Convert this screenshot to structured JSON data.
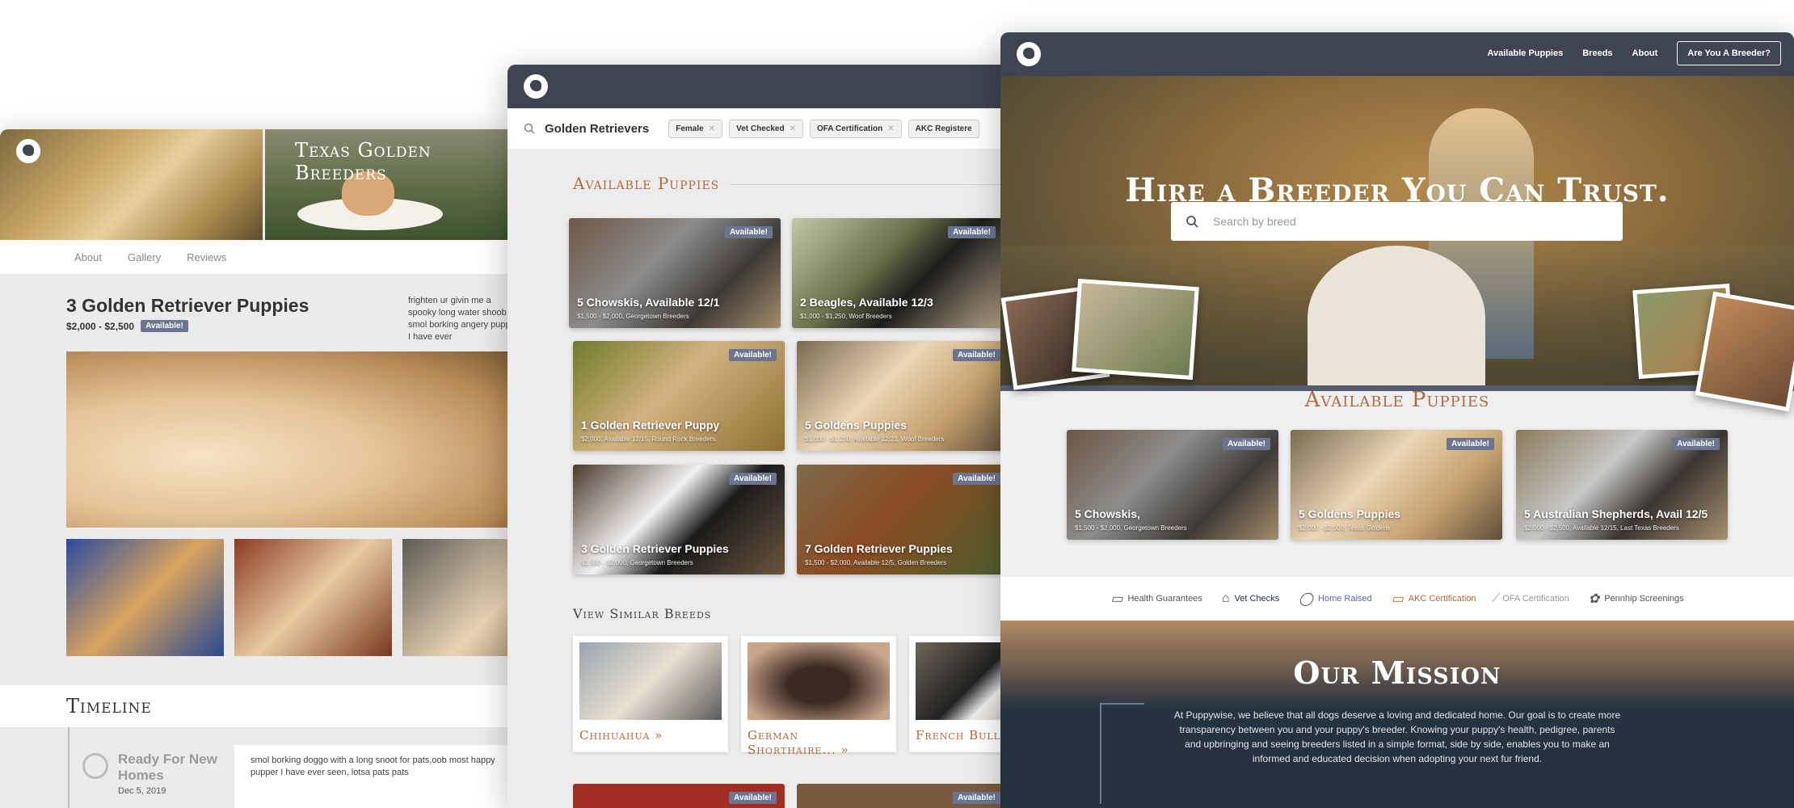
{
  "profile": {
    "breeder_name": "Texas Golden Breeders",
    "nav": [
      "About",
      "Gallery",
      "Reviews"
    ],
    "listing_title": "3 Golden Retriever Puppies",
    "price": "$2,000 - $2,500",
    "badge": "Available!",
    "description": "frighten ur givin me a spooky long water shoob smol borking angery pupper I have ever",
    "timeline_title": "Timeline",
    "timeline_event": {
      "heading": "Ready For New Homes",
      "date": "Dec 5, 2019",
      "text": "smol borking doggo with a long snoot for pats,oob most happy pupper I have ever seen, lotsa pats pats"
    }
  },
  "search": {
    "query": "Golden Retrievers",
    "filters": [
      "Female",
      "Vet Checked",
      "OFA Certification",
      "AKC Registere"
    ],
    "available_heading": "Available Puppies",
    "cards": [
      {
        "title": "5 Chowskis, Available 12/1",
        "sub": "$1,500 - $2,000, Georgetown Breeders",
        "badge": "Available!"
      },
      {
        "title": "2 Beagles, Available 12/3",
        "sub": "$1,000 - $1,250, Woof Breeders",
        "badge": "Available!"
      },
      {
        "title": "1 Golden Retriever Puppy",
        "sub": "$2,000, Available 12/15, Round Rock Breeders",
        "badge": "Available!"
      },
      {
        "title": "5 Goldens Puppies",
        "sub": "$1,000 - $1,250, Available 12/23, Woof Breeders",
        "badge": "Available!"
      },
      {
        "title": "3 Golden Retriever Puppies",
        "sub": "$1,500 - $2,000, Georgetown Breeders",
        "badge": "Available!"
      },
      {
        "title": "7 Golden Retriever Puppies",
        "sub": "$1,500 - $2,000, Available 12/5, Golden Breeders",
        "badge": "Available!"
      }
    ],
    "similar_heading": "View Similar Breeds",
    "similar": [
      "Chihuahua »",
      "German Shorthaire... »",
      "French Bulldo"
    ],
    "bottom_badges": [
      "Available!",
      "Available!"
    ]
  },
  "home": {
    "nav": [
      "Available Puppies",
      "Breeds",
      "About"
    ],
    "cta": "Are You A Breeder?",
    "hero_title": "Hire a Breeder You Can Trust.",
    "search_placeholder": "Search by breed",
    "available_heading": "Available Puppies",
    "cards": [
      {
        "title": "5 Chowskis,",
        "sub": "$1,500 - $2,000, Georgetown Breeders",
        "badge": "Available!"
      },
      {
        "title": "5 Goldens Puppies",
        "sub": "$2,000 - $2,500, Texas Goldens",
        "badge": "Available!"
      },
      {
        "title": "5 Australian Shepherds, Avail 12/5",
        "sub": "$2,000 - $2,500, Available 12/15, Last Texas Breeders",
        "badge": "Available!"
      }
    ],
    "features": [
      {
        "label": "Health Guarantees",
        "icon": "certificate-icon",
        "color": "#555555"
      },
      {
        "label": "Vet Checks",
        "icon": "clinic-icon",
        "color": "#25323f"
      },
      {
        "label": "Home Raised",
        "icon": "apple-icon",
        "color": "#5a6a9a"
      },
      {
        "label": "AKC Certification",
        "icon": "certificate-icon",
        "color": "#b36a3f"
      },
      {
        "label": "OFA Certification",
        "icon": "bone-icon",
        "color": "#999999"
      },
      {
        "label": "Pennhip Screenings",
        "icon": "paw-icon",
        "color": "#555555"
      }
    ],
    "mission_title": "Our Mission",
    "mission_text": "At Puppywise, we believe that all dogs deserve a loving and dedicated home. Our goal is to create more transparency between you and your puppy's breeder. Knowing your puppy's health, pedigree, parents and upbringing and seeing breeders listed in a simple format, side by side, enables you to make an informed and educated decision when adopting your next fur friend."
  },
  "colors": {
    "navbar": "#3f4452",
    "accent": "#b36a3f",
    "badge": "#6b7590",
    "mission_bg": "#25323f"
  }
}
